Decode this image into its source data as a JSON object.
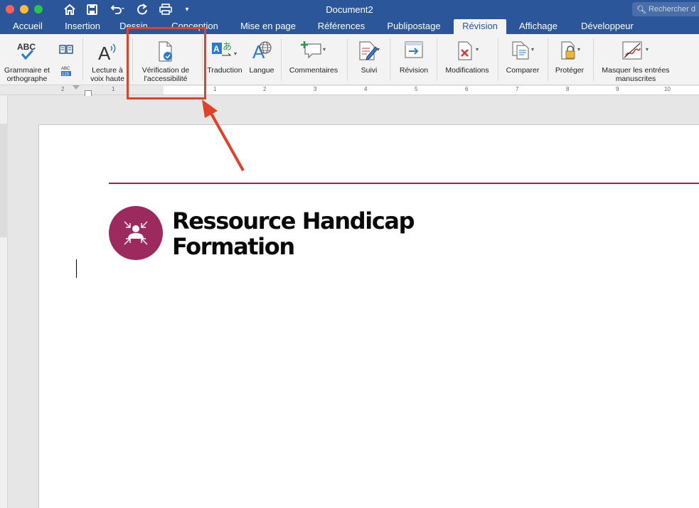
{
  "window": {
    "title": "Document2",
    "search_placeholder": "Rechercher d"
  },
  "tabs": [
    {
      "label": "Accueil"
    },
    {
      "label": "Insertion"
    },
    {
      "label": "Dessin"
    },
    {
      "label": "Conception"
    },
    {
      "label": "Mise en page"
    },
    {
      "label": "Références"
    },
    {
      "label": "Publipostage"
    },
    {
      "label": "Révision",
      "active": true
    },
    {
      "label": "Affichage"
    },
    {
      "label": "Développeur"
    }
  ],
  "ribbon": {
    "grammar": {
      "label1": "Grammaire et",
      "label2": "orthographe",
      "icon_text": "ABC"
    },
    "read_aloud": {
      "label1": "Lecture à",
      "label2": "voix haute"
    },
    "accessibility": {
      "label1": "Vérification de",
      "label2": "l'accessibilité"
    },
    "translate": {
      "label": "Traduction"
    },
    "language": {
      "label": "Langue"
    },
    "comments": {
      "label": "Commentaires"
    },
    "tracking": {
      "label": "Suivi"
    },
    "revision": {
      "label": "Révision"
    },
    "changes": {
      "label": "Modifications"
    },
    "compare": {
      "label": "Comparer"
    },
    "protect": {
      "label": "Protéger"
    },
    "ink": {
      "label1": "Masquer les entrées",
      "label2": "manuscrites"
    },
    "wordcount_icon_text": "ABC\n123"
  },
  "ruler": {
    "numbers": [
      "2",
      "1",
      "1",
      "2",
      "3",
      "4",
      "5",
      "6",
      "7",
      "8",
      "9",
      "10"
    ]
  },
  "document": {
    "logo_line1": "Ressource Handicap",
    "logo_line2": "Formation"
  },
  "colors": {
    "brand_blue": "#2b579a",
    "logo_magenta": "#9c2a5f",
    "annotation_red": "#e0412b"
  }
}
